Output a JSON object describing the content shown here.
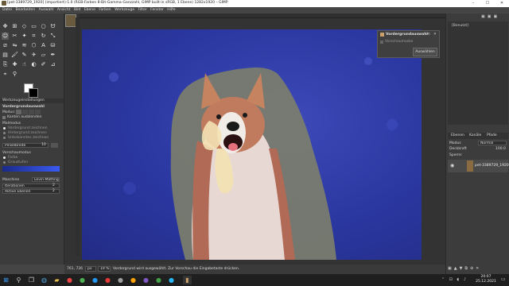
{
  "window": {
    "title": "[pet-3389729_1920] (importiert)-1.0 (RGB-Farben 8-Bit-Gamma-Ganzzahl, GIMP built-in sRGB, 1 Ebene) 1282x1920 – GIMP",
    "minimize": "–",
    "maximize": "☐",
    "close": "✕"
  },
  "menu": [
    "Datei",
    "Bearbeiten",
    "Auswahl",
    "Ansicht",
    "Bild",
    "Ebene",
    "Farben",
    "Werkzeuge",
    "Filter",
    "Fenster",
    "Hilfe"
  ],
  "toolbox": {
    "tools": [
      "move",
      "align",
      "free-select",
      "rect-select",
      "ellipse-select",
      "lasso",
      "fuzzy-select",
      "scissors",
      "foreground-select",
      "crop",
      "rotate",
      "scale",
      "shear",
      "flip",
      "warp",
      "cage",
      "text",
      "bucket-fill",
      "gradient",
      "paintbrush",
      "pencil",
      "airbrush",
      "eraser",
      "ink",
      "clone",
      "heal",
      "smudge",
      "dodge",
      "color-picker",
      "zoom",
      "measure",
      "paths"
    ],
    "tool_options_tab": "Werkzeugeinstellungen",
    "tool_options_title": "Vordergrundauswahl",
    "modus_label": "Modus:",
    "kanten_label": "Kanten ausblenden",
    "malmodus_label": "Malmodus",
    "malmodus_options": [
      "Vordergrund zeichnen",
      "Hintergrund zeichnen",
      "Unbekanntes zeichnen"
    ],
    "pinsel_label": "Pinselbreite",
    "pinsel_value": "10",
    "vorschau_label": "Vorschaumodus",
    "vorschau_options": [
      "Farbe",
      "Graustufen"
    ],
    "engine_label": "Maschine",
    "engine_value": "Levin-Matting",
    "iterations_label": "Iterationen",
    "iterations_value": "2",
    "aktive_label": "Aktive Ebenen",
    "aktive_value": "2"
  },
  "dialog": {
    "title": "Vordergrundauswahl",
    "preview_label": "Vorschaumaske",
    "select_button": "Auswählen"
  },
  "status": {
    "coords": "761, 726",
    "unit": "px",
    "zoom": "19 %",
    "message": "Vordergrund wird ausgewählt. Zur Vorschau die Eingabetaste drücken."
  },
  "right_panel": {
    "images_label": "[Benutzt]",
    "tabs": [
      "Ebenen",
      "Kanäle",
      "Pfade"
    ],
    "modus_label": "Modus",
    "modus_value": "Normal",
    "deckkraft_label": "Deckkraft",
    "deckkraft_value": "100.0",
    "sperre_label": "Sperre:",
    "layer_name": "pet-3389729_1920"
  },
  "taskbar": {
    "time": "20:07",
    "date": "25.12.2021"
  },
  "colors": {
    "canvas_blue": "#2d3ba6",
    "selection_overlay": "#7d7f6a",
    "foreground_marks": "#f3e2b4",
    "ui_bg": "#3c3c3c"
  }
}
